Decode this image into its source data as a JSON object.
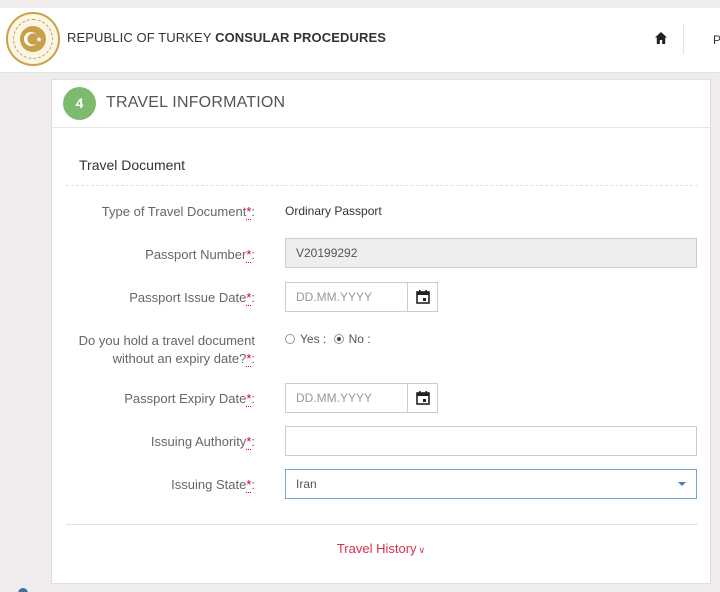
{
  "header": {
    "title_part1": "REPUBLIC OF TURKEY",
    "title_part2": "CONSULAR PROCEDURES",
    "home_icon": "home-icon",
    "nav_next_label": "P"
  },
  "card": {
    "step_number": "4",
    "title": "TRAVEL INFORMATION",
    "section_title": "Travel Document",
    "fields": {
      "doc_type": {
        "label": "Type of Travel Document",
        "value": "Ordinary Passport"
      },
      "passport_number": {
        "label": "Passport Number",
        "value": "V20199292"
      },
      "issue_date": {
        "label": "Passport Issue Date",
        "placeholder": "DD.MM.YYYY"
      },
      "no_expiry": {
        "label_line1": "Do you hold a travel document",
        "label_line2": "without an expiry date?",
        "yes_label": "Yes :",
        "no_label": "No :",
        "selected": "No"
      },
      "expiry_date": {
        "label": "Passport Expiry Date",
        "placeholder": "DD.MM.YYYY"
      },
      "issuing_authority": {
        "label": "Issuing Authority",
        "value": ""
      },
      "issuing_state": {
        "label": "Issuing State",
        "value": "Iran"
      }
    },
    "required_mark": "*",
    "colon": ":",
    "travel_history_link": "Travel History",
    "travel_history_icon": "chevron-down-icon"
  },
  "colors": {
    "accent_red": "#d9304a",
    "step_badge": "#7dba6e",
    "select_border": "#7aa6cf"
  }
}
